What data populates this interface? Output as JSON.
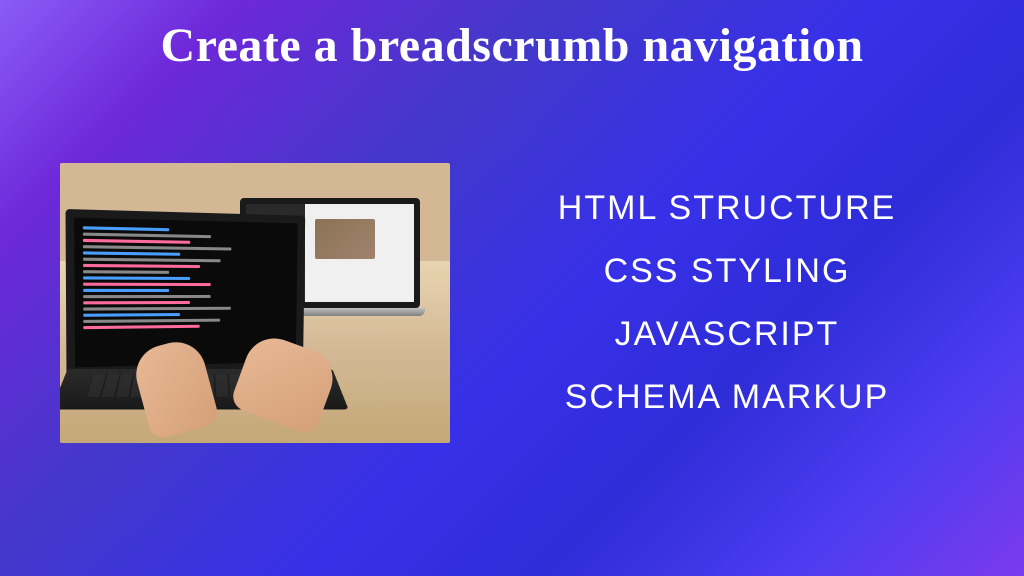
{
  "title": "Create a breadscrumb navigation",
  "topics": {
    "item1": "HTML STRUCTURE",
    "item2": "CSS STYLING",
    "item3": "JAVASCRIPT",
    "item4": "SCHEMA MARKUP"
  }
}
